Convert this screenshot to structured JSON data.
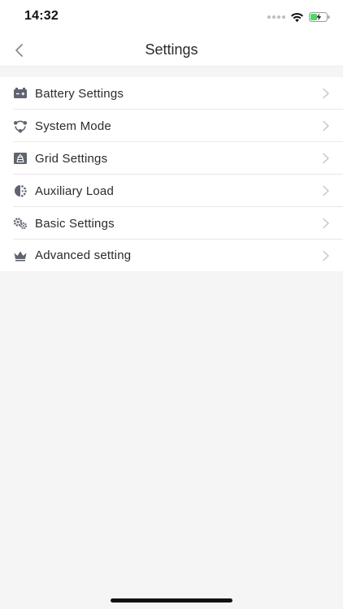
{
  "status_bar": {
    "time": "14:32",
    "icons": [
      "cellular-dots-icon",
      "wifi-icon",
      "battery-charging-icon"
    ]
  },
  "nav": {
    "title": "Settings",
    "back_icon": "chevron-left-icon"
  },
  "menu": {
    "items": [
      {
        "label": "Battery Settings",
        "icon": "battery-icon"
      },
      {
        "label": "System Mode",
        "icon": "system-mode-icon"
      },
      {
        "label": "Grid Settings",
        "icon": "grid-icon"
      },
      {
        "label": "Auxiliary Load",
        "icon": "auxiliary-load-icon"
      },
      {
        "label": "Basic Settings",
        "icon": "gears-icon"
      },
      {
        "label": "Advanced setting",
        "icon": "crown-icon"
      }
    ],
    "chevron_icon": "chevron-right-icon"
  },
  "colors": {
    "background": "#f4f5f4",
    "surface": "#ffffff",
    "icon": "#5f6470",
    "chevron": "#c4c4c4",
    "battery_fill": "#4cd964"
  }
}
